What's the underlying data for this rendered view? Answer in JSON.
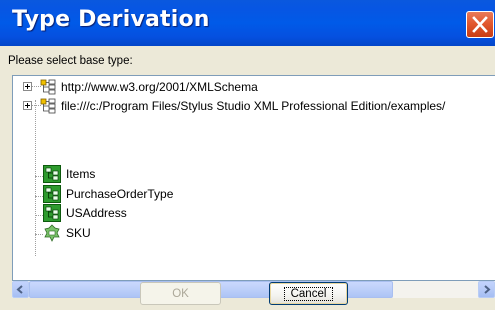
{
  "window": {
    "title": "Type Derivation"
  },
  "prompt": "Please select base type:",
  "tree": {
    "items": [
      {
        "label": "http://www.w3.org/2001/XMLSchema",
        "kind": "namespace",
        "expandable": true
      },
      {
        "label": "file:///c:/Program Files/Stylus Studio XML Professional Edition/examples/",
        "kind": "namespace",
        "expandable": true
      },
      {
        "label": "Items",
        "kind": "complex-type",
        "expandable": false
      },
      {
        "label": "PurchaseOrderType",
        "kind": "complex-type",
        "expandable": false
      },
      {
        "label": "USAddress",
        "kind": "complex-type",
        "expandable": false
      },
      {
        "label": "SKU",
        "kind": "simple-type",
        "expandable": false
      }
    ]
  },
  "buttons": {
    "ok": "OK",
    "cancel": "Cancel"
  },
  "icons": {
    "close": "close-icon",
    "namespace": "namespace-tree-icon",
    "complex_type": "complex-type-icon",
    "simple_type": "simple-type-icon",
    "scroll_left": "arrow-left-icon",
    "scroll_right": "arrow-right-icon"
  },
  "colors": {
    "titlebar": "#0055e5",
    "close_button": "#e2582f",
    "dialog_bg": "#ece9d8",
    "selection_green": "#2e9b2e"
  }
}
